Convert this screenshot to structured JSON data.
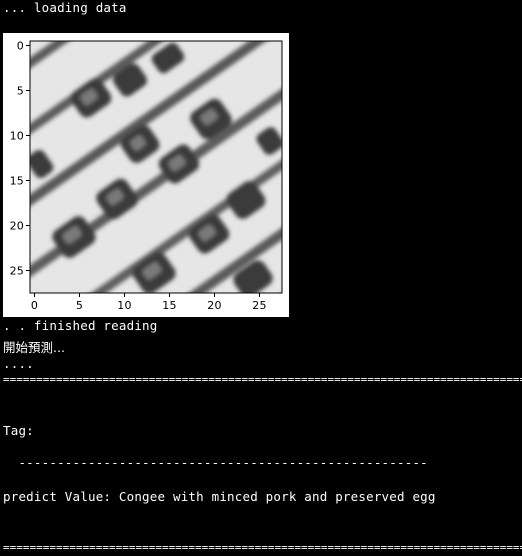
{
  "console": {
    "loading_line": "... loading data",
    "finished_line": ". . finished reading",
    "predict_start_line": "開始預測...",
    "dots_line": "....",
    "separator_line": "==========================================================================================",
    "tag_label": "Tag:",
    "dash_line": "  -----------------------------------------------------",
    "predict_value_line": "predict Value: Congee with minced pork and preserved egg",
    "final_separator_line": "=========================================================================================="
  },
  "figure": {
    "type": "heatmap",
    "colormap": "grayscale",
    "x_ticks": [
      "0",
      "5",
      "10",
      "15",
      "20",
      "25"
    ],
    "y_ticks": [
      "0",
      "5",
      "10",
      "15",
      "20",
      "25"
    ],
    "xlim": [
      0,
      27
    ],
    "ylim": [
      0,
      27
    ]
  }
}
